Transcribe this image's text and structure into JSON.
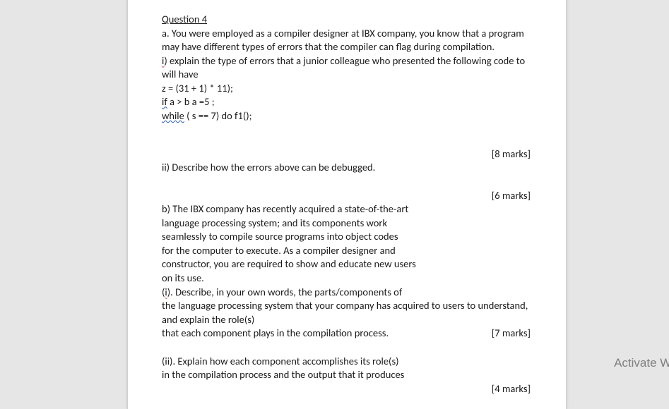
{
  "question": {
    "title": "Question 4",
    "a_intro_l1": "a. You were employed as a compiler designer at IBX company, you know that a program",
    "a_intro_l2": "may have different types of errors that the compiler can flag during compilation.",
    "a_i_l1a": "i",
    "a_i_l1b": ") explain the type of errors that a junior colleague who presented the following code to",
    "a_i_l2": "will have",
    "code_l1": "z = (31 + 1) * 11);",
    "code_if": "if",
    "code_l2_rest": " a > b  a =5 ;",
    "code_while": "while",
    "code_l3_rest": " ( s == 7) do f1();",
    "marks_8": "[8 marks]",
    "a_ii": "ii) Describe how the errors above can be debugged.",
    "marks_6": "[6 marks]",
    "b_l1": "b) The IBX company has recently acquired a state-of-the-art",
    "b_l2": "language processing system; and its components work",
    "b_l3": "seamlessly to compile source programs into object codes",
    "b_l4": "for the computer to execute. As a compiler designer and",
    "b_l5": "constructor, you are required to show and educate new users",
    "b_l6": "on its use.",
    "b_i_l1a": "(",
    "b_i_l1b": "i",
    "b_i_l1c": "). Describe, in your own words, the parts/components of",
    "b_i_l2": "the language processing system that your company has acquired to users to understand,",
    "b_i_l3": "and explain the role(s)",
    "b_i_l4": "that each component plays in the compilation process.",
    "marks_7": "[7 marks]",
    "b_ii_l1": "(ii). Explain how each component accomplishes its role(s)",
    "b_ii_l2": "in the compilation process and the output that it produces",
    "marks_4": "[4 marks]"
  },
  "watermark": "Activate Wind"
}
